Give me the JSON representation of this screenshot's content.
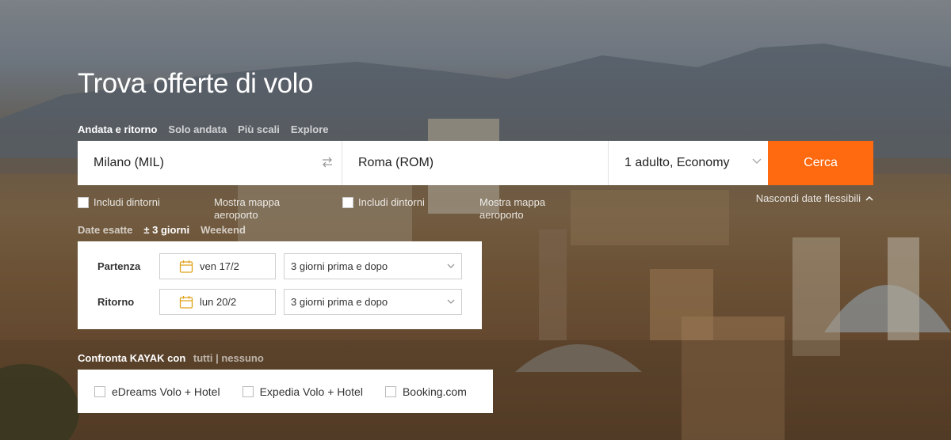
{
  "page": {
    "title": "Trova offerte di volo"
  },
  "trip_tabs": [
    {
      "label": "Andata e ritorno",
      "active": true
    },
    {
      "label": "Solo andata",
      "active": false
    },
    {
      "label": "Più scali",
      "active": false
    },
    {
      "label": "Explore",
      "active": false
    }
  ],
  "search": {
    "origin": "Milano (MIL)",
    "destination": "Roma (ROM)",
    "passengers": "1 adulto, Economy",
    "button_label": "Cerca"
  },
  "options": {
    "origin_nearby": "Includi dintorni",
    "origin_map": "Mostra mappa aeroporto",
    "dest_nearby": "Includi dintorni",
    "dest_map": "Mostra mappa aeroporto",
    "flexible_toggle": "Nascondi date flessibili"
  },
  "date_tabs": [
    {
      "label": "Date esatte",
      "active": false
    },
    {
      "label": "± 3 giorni",
      "active": true
    },
    {
      "label": "Weekend",
      "active": false
    }
  ],
  "dates": {
    "departure_label": "Partenza",
    "departure_value": "ven 17/2",
    "departure_flex": "3 giorni prima e dopo",
    "return_label": "Ritorno",
    "return_value": "lun 20/2",
    "return_flex": "3 giorni prima e dopo"
  },
  "compare": {
    "title": "Confronta KAYAK con",
    "all": "tutti",
    "separator": "|",
    "none": "nessuno",
    "items": [
      "eDreams Volo + Hotel",
      "Expedia Volo + Hotel",
      "Booking.com"
    ]
  },
  "colors": {
    "accent": "#ff690f"
  }
}
